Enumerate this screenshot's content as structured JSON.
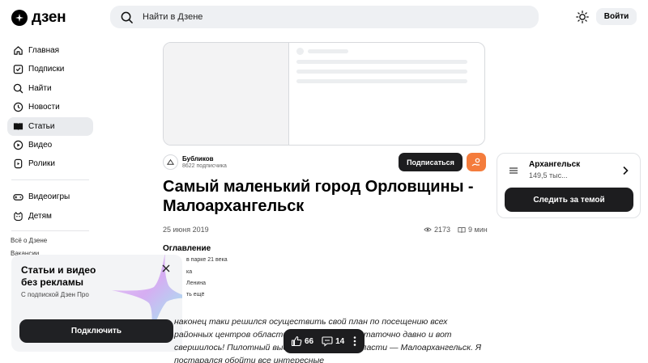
{
  "header": {
    "logo_text": "дзен",
    "search_placeholder": "Найти в Дзене",
    "login_label": "Войти"
  },
  "sidebar": {
    "items": [
      {
        "label": "Главная",
        "icon": "home-icon"
      },
      {
        "label": "Подписки",
        "icon": "subscriptions-icon"
      },
      {
        "label": "Найти",
        "icon": "search-icon"
      },
      {
        "label": "Новости",
        "icon": "news-icon"
      },
      {
        "label": "Статьи",
        "icon": "articles-icon",
        "active": true
      },
      {
        "label": "Видео",
        "icon": "video-icon"
      },
      {
        "label": "Ролики",
        "icon": "shorts-icon"
      }
    ],
    "items2": [
      {
        "label": "Видеоигры",
        "icon": "gamepad-icon"
      },
      {
        "label": "Детям",
        "icon": "kids-icon"
      }
    ],
    "links": [
      "Всё о Дзене",
      "Вакансии"
    ]
  },
  "promo": {
    "title": "Статьи и видео без рекламы",
    "subtitle": "С подпиской Дзен Про",
    "button": "Подключить"
  },
  "article": {
    "author_name": "Бубликов",
    "author_subs": "8622 подписчика",
    "subscribe_label": "Подписаться",
    "title": "Самый маленький город Орловщины - Малоархангельск",
    "date": "25 июня 2019",
    "views": "2173",
    "read_time": "9 мин",
    "toc_title": "Оглавление",
    "toc_items": [
      "в парке 21 века",
      "ка",
      "Ленина",
      "ть ещё"
    ],
    "body": "наконец таки решился осуществить свой план по посещению всех районных центров области. Эта мысль ... достаточно давно и вот свершилось! Пилотный выезд ... ший город области — Малоархангельск. Я постарался обойти все интересные"
  },
  "reactions": {
    "likes": "66",
    "comments": "14"
  },
  "topic": {
    "name": "Архангельск",
    "count": "149,5 тыс...",
    "button": "Следить за темой"
  }
}
